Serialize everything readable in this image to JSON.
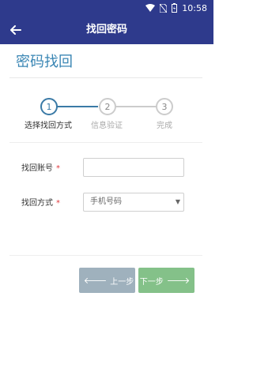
{
  "status": {
    "time": "10:58"
  },
  "header": {
    "title": "找回密码"
  },
  "page": {
    "title": "密码找回"
  },
  "steps": [
    {
      "num": "1",
      "label": "选择找回方式"
    },
    {
      "num": "2",
      "label": "信息验证"
    },
    {
      "num": "3",
      "label": "完成"
    }
  ],
  "form": {
    "account_label": "找回账号",
    "required_mark": "*",
    "account_value": "",
    "method_label": "找回方式",
    "method_value": "手机号码"
  },
  "buttons": {
    "prev_label": "上一步",
    "next_label": "下一步"
  },
  "colors": {
    "primary": "#2e3a8c",
    "accent": "#3a86b4",
    "next": "#84c189",
    "prev": "#9fb1bd",
    "required": "#e0393e"
  }
}
